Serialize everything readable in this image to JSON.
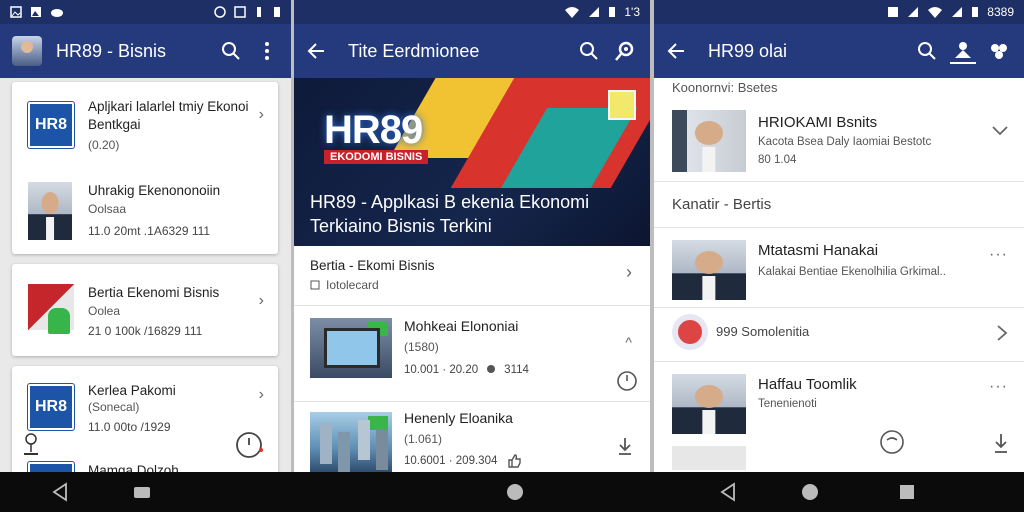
{
  "status_bar": {
    "right_time": "1'3",
    "right_time_alt": "8389"
  },
  "pane1": {
    "app_title": "HR89 - Bisnis",
    "cards": [
      {
        "logo_text": "HR8",
        "title": "Apljkari lalarlel tmiy Ekonoi Bentkgai",
        "meta": "(0.20)",
        "stats": ""
      },
      {
        "title": "Uhrakig Ekenononoiin",
        "meta": "Oolsaa",
        "stats": "11.0 20mt .1A6329 111"
      },
      {
        "title": "Bertia Ekenomi Bisnis",
        "meta": "Oolea",
        "stats": "21 0 100k /16829 111"
      },
      {
        "logo_text": "HR8",
        "title": "Kerlea Pakomi",
        "meta": "(Sonecal)",
        "stats": "11.0 00to /1929"
      },
      {
        "title": "Mamga Dolzoh",
        "meta": "",
        "stats": ""
      }
    ]
  },
  "pane2": {
    "app_title": "Tite Eerdmionee",
    "hero": {
      "brand": "HR89",
      "sub": "EKODOMI BISNIS",
      "caption": "HR89 - Applkasi B ekenia Ekonomi Terkiaino Bisnis Terkini"
    },
    "section": {
      "title": "Bertia - Ekomi Bisnis",
      "subtitle": "Iotolecard"
    },
    "items": [
      {
        "title": "Mohkeai Elononiai",
        "meta": "(1580)",
        "stats": "10.001 · 20.20",
        "count": "3114"
      },
      {
        "title": "Henenly Eloanika",
        "meta": "(1.061)",
        "stats": "10.6001 · 209.304"
      }
    ]
  },
  "pane3": {
    "app_title": "HR99 olai",
    "section_top": "Koonornvi: Bsetes",
    "top_item": {
      "title": "HRIOKAMI Bsnits",
      "desc": "Kacota Bsea Daly Iaomiai Bestotc",
      "meta": "80 1.04"
    },
    "section_mid": "Kanatir - Bertis",
    "items": [
      {
        "title": "Mtatasmi Hanakai",
        "desc": "Kalakai Bentiae Ekenolhilia Grkimal.."
      },
      {
        "title": "999 Somolenitia",
        "desc": ""
      },
      {
        "title": "Haffau Toomlik",
        "desc": "Tenenienoti"
      }
    ]
  }
}
